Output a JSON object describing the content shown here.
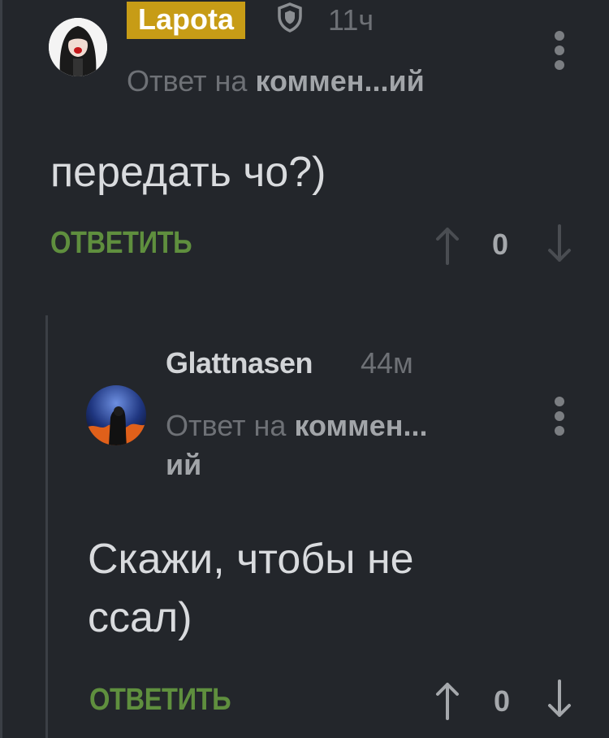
{
  "comments": [
    {
      "username": "Lapota",
      "time": "11ч",
      "reply_prefix": "Ответ на ",
      "reply_target": "коммен...ий",
      "text": "передать чо?)",
      "reply_label": "ОТВЕТИТЬ",
      "votes": "0"
    },
    {
      "username": "Glattnasen",
      "time": "44м",
      "reply_prefix": "Ответ на ",
      "reply_target": "коммен...",
      "reply_target_cont": "ий",
      "text_line1": "Скажи, чтобы не",
      "text_line2": "ссал)",
      "reply_label": "ОТВЕТИТЬ",
      "votes": "0"
    }
  ],
  "colors": {
    "background": "#23262b",
    "badge": "#c79c16",
    "reply_action": "#5f8f3e",
    "muted_text": "#6e7176"
  }
}
